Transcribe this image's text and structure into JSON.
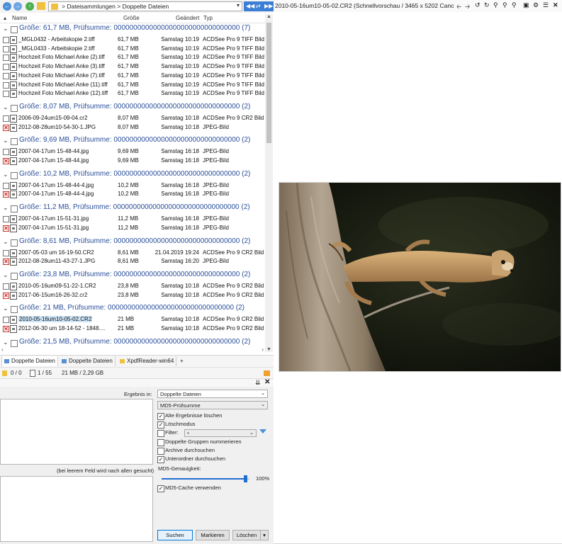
{
  "toolbar": {
    "breadcrumb_1": "Dateisammlungen",
    "breadcrumb_sep": ">",
    "breadcrumb_2": "Doppelte Dateien"
  },
  "columns": {
    "name": "Name",
    "size": "Größe",
    "changed": "Geändert",
    "type": "Typ"
  },
  "groups": [
    {
      "label": "Größe: 61,7 MB, Prüfsumme: 00000000000000000000000000000000 (7)",
      "files": [
        {
          "name": "_MGL0432 - Arbeitskopie 2.tiff",
          "size": "61,7 MB",
          "date": "Samstag  10:19",
          "type": "ACDSee Pro 9 TIFF Bild",
          "marked": false
        },
        {
          "name": "_MGL0433 - Arbeitskopie 2.tiff",
          "size": "61,7 MB",
          "date": "Samstag  10:19",
          "type": "ACDSee Pro 9 TIFF Bild",
          "marked": false
        },
        {
          "name": "Hochzeit Foto Michael Anke (2).tiff",
          "size": "61,7 MB",
          "date": "Samstag  10:19",
          "type": "ACDSee Pro 9 TIFF Bild",
          "marked": false
        },
        {
          "name": "Hochzeit Foto Michael Anke (3).tiff",
          "size": "61,7 MB",
          "date": "Samstag  10:19",
          "type": "ACDSee Pro 9 TIFF Bild",
          "marked": false
        },
        {
          "name": "Hochzeit Foto Michael Anke (7).tiff",
          "size": "61,7 MB",
          "date": "Samstag  10:19",
          "type": "ACDSee Pro 9 TIFF Bild",
          "marked": false
        },
        {
          "name": "Hochzeit Foto Michael Anke (11).tiff",
          "size": "61,7 MB",
          "date": "Samstag  10:19",
          "type": "ACDSee Pro 9 TIFF Bild",
          "marked": false
        },
        {
          "name": "Hochzeit Foto Michael Anke (12).tiff",
          "size": "61,7 MB",
          "date": "Samstag  10:19",
          "type": "ACDSee Pro 9 TIFF Bild",
          "marked": false
        }
      ]
    },
    {
      "label": "Größe: 8,07 MB, Prüfsumme: 00000000000000000000000000000000 (2)",
      "files": [
        {
          "name": "2006-09-24um15-09-04.cr2",
          "size": "8,07 MB",
          "date": "Samstag  10:18",
          "type": "ACDSee Pro 9 CR2 Bild",
          "marked": false
        },
        {
          "name": "2012-08-28um10-54-30-1.JPG",
          "size": "8,07 MB",
          "date": "Samstag  10:18",
          "type": "JPEG-Bild",
          "marked": true
        }
      ]
    },
    {
      "label": "Größe: 9,69 MB, Prüfsumme: 00000000000000000000000000000000 (2)",
      "files": [
        {
          "name": "2007-04-17um 15-48-44.jpg",
          "size": "9,69 MB",
          "date": "Samstag  16:18",
          "type": "JPEG-Bild",
          "marked": false
        },
        {
          "name": "2007-04-17um 15-48-44.jpg",
          "size": "9,69 MB",
          "date": "Samstag  16:18",
          "type": "JPEG-Bild",
          "marked": true
        }
      ]
    },
    {
      "label": "Größe: 10,2 MB, Prüfsumme: 00000000000000000000000000000000 (2)",
      "files": [
        {
          "name": "2007-04-17um 15-48-44-4.jpg",
          "size": "10,2 MB",
          "date": "Samstag  16:18",
          "type": "JPEG-Bild",
          "marked": false
        },
        {
          "name": "2007-04-17um 15-48-44-4.jpg",
          "size": "10,2 MB",
          "date": "Samstag  16:18",
          "type": "JPEG-Bild",
          "marked": true
        }
      ]
    },
    {
      "label": "Größe: 11,2 MB, Prüfsumme: 00000000000000000000000000000000 (2)",
      "files": [
        {
          "name": "2007-04-17um 15-51-31.jpg",
          "size": "11,2 MB",
          "date": "Samstag  16:18",
          "type": "JPEG-Bild",
          "marked": false
        },
        {
          "name": "2007-04-17um 15-51-31.jpg",
          "size": "11,2 MB",
          "date": "Samstag  16:18",
          "type": "JPEG-Bild",
          "marked": true
        }
      ]
    },
    {
      "label": "Größe: 8,61 MB, Prüfsumme: 00000000000000000000000000000000 (2)",
      "files": [
        {
          "name": "2007-05-03 um 16-19-50.CR2",
          "size": "8,61 MB",
          "date": "21.04.2019  19:24",
          "type": "ACDSee Pro 9 CR2 Bild",
          "marked": false
        },
        {
          "name": "2012-08-28um11-43-27-1.JPG",
          "size": "8,61 MB",
          "date": "Samstag  16:20",
          "type": "JPEG-Bild",
          "marked": true
        }
      ]
    },
    {
      "label": "Größe: 23,8 MB, Prüfsumme: 00000000000000000000000000000000 (2)",
      "files": [
        {
          "name": "2010-05-16um09-51-22-1.CR2",
          "size": "23,8 MB",
          "date": "Samstag  10:18",
          "type": "ACDSee Pro 9 CR2 Bild",
          "marked": false
        },
        {
          "name": "2017-06-15um16-26-32.cr2",
          "size": "23,8 MB",
          "date": "Samstag  10:18",
          "type": "ACDSee Pro 9 CR2 Bild",
          "marked": true
        }
      ]
    },
    {
      "label": "Größe: 21 MB, Prüfsumme: 00000000000000000000000000000000 (2)",
      "files": [
        {
          "name": "2010-05-16um10-05-02.CR2",
          "size": "21 MB",
          "date": "Samstag  10:18",
          "type": "ACDSee Pro 9 CR2 Bild",
          "marked": false,
          "selected": true
        },
        {
          "name": "2012-06-30 um 18-14-52 - 1848....",
          "size": "21 MB",
          "date": "Samstag  10:18",
          "type": "ACDSee Pro 9 CR2 Bild",
          "marked": true
        }
      ]
    },
    {
      "label": "Größe: 21,5 MB, Prüfsumme: 00000000000000000000000000000000 (2)",
      "files": [
        {
          "name": "2010-05-16um14-45-07.CR2",
          "size": "21,5 MB",
          "date": "Samstag  10:18",
          "type": "ACDSee Pro 9 CR2 Bild",
          "marked": false
        },
        {
          "name": "2012-06-30 um 16-26-44 - 1676....",
          "size": "21,5 MB",
          "date": "Samstag  10:18",
          "type": "ACDSee Pro 9 CR2 Bild",
          "marked": true
        }
      ]
    }
  ],
  "tabs": [
    {
      "label": "Doppelte Dateien",
      "active": true
    },
    {
      "label": "Doppelte Dateien",
      "active": false
    },
    {
      "label": "XpdfReader-win64",
      "active": false
    }
  ],
  "tab_add": "+",
  "status": {
    "selection": "0 / 0",
    "count": "1 / 55",
    "size": "21 MB / 2,29 GB"
  },
  "find": {
    "result_label": "Ergebnis in:",
    "result_value": "Doppelte Dateien",
    "method_value": "MD5-Prüfsumme",
    "empty_hint": "(bei leerem Feld wird nach allen gesucht)",
    "filter_value": "*",
    "md5_accuracy_label": "MD5-Genauigkeit:",
    "md5_accuracy_value": "100%",
    "md5_accuracy": 1.0,
    "options": [
      {
        "label": "Alte Ergebnisse löschen",
        "checked": true
      },
      {
        "label": "Löschmodus",
        "checked": true
      },
      {
        "label": "Filter:",
        "checked": false
      },
      {
        "label": "Doppelte Gruppen nummerieren",
        "checked": false
      },
      {
        "label": "Archive durchsuchen",
        "checked": false
      },
      {
        "label": "Unterordner durchsuchen",
        "checked": true
      }
    ],
    "md5_cache_label": "MD5-Cache verwenden",
    "md5_cache_checked": true,
    "buttons": {
      "search": "Suchen",
      "mark": "Markieren",
      "delete": "Löschen"
    }
  },
  "preview": {
    "title": "2010-05-16um10-05-02.CR2 (Schnellvorschau / 3465 x 5202 Canon ..."
  },
  "colors": {
    "accent": "#1f6fd1",
    "group_text": "#2a4f9a",
    "marked_red": "#d21f1f",
    "selection": "#cde4f7"
  }
}
